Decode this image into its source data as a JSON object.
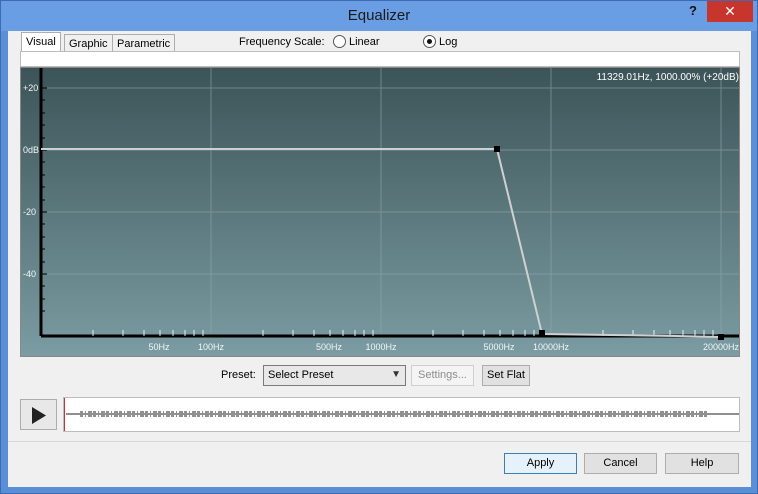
{
  "window": {
    "title": "Equalizer",
    "help_label": "?",
    "close_label": "✕"
  },
  "tabs": [
    {
      "label": "Visual",
      "active": true
    },
    {
      "label": "Graphic",
      "active": false
    },
    {
      "label": "Parametric",
      "active": false
    }
  ],
  "frequency_scale": {
    "label": "Frequency Scale:",
    "options": [
      {
        "label": "Linear",
        "checked": false
      },
      {
        "label": "Log",
        "checked": true
      }
    ]
  },
  "graph": {
    "readout": "11329.01Hz, 1000.00% (+20dB)",
    "y_labels": [
      "+20",
      "0dB",
      "-20",
      "-40"
    ],
    "x_labels": [
      "50Hz",
      "100Hz",
      "500Hz",
      "1000Hz",
      "5000Hz",
      "10000Hz",
      "20000Hz"
    ],
    "curve_color": "#d0d0d0",
    "point_color": "#000000"
  },
  "preset": {
    "label": "Preset:",
    "value": "Select Preset",
    "settings_label": "Settings...",
    "set_flat_label": "Set Flat"
  },
  "footer": {
    "apply_label": "Apply",
    "cancel_label": "Cancel",
    "help_label": "Help"
  },
  "icons": {
    "play": "play-icon"
  }
}
